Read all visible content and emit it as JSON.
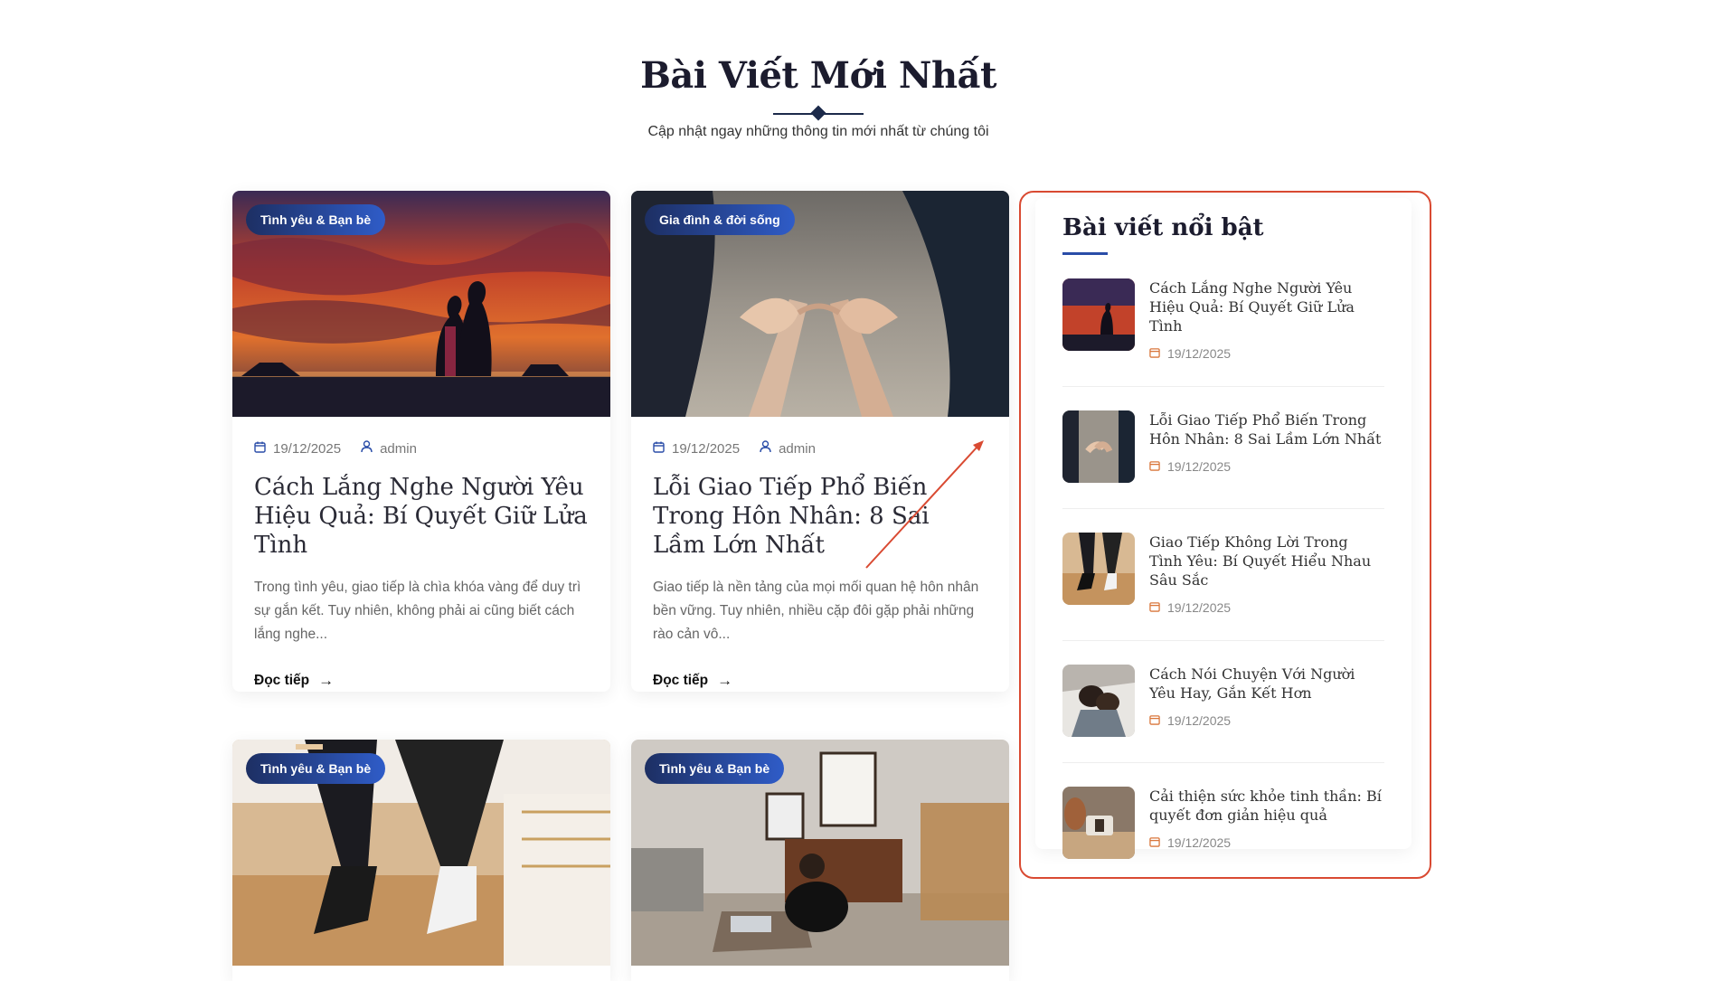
{
  "section": {
    "title": "Bài Viết Mới Nhất",
    "subtitle": "Cập nhật ngay những thông tin mới nhất từ chúng tôi"
  },
  "posts": [
    {
      "category": "Tình yêu & Bạn bè",
      "date": "19/12/2025",
      "author": "admin",
      "title": "Cách Lắng Nghe Người Yêu Hiệu Quả: Bí Quyết Giữ Lửa Tình",
      "excerpt": "Trong tình yêu, giao tiếp là chìa khóa vàng để duy trì sự gắn kết. Tuy nhiên, không phải ai cũng biết cách lắng nghe...",
      "read_more": "Đọc tiếp",
      "image": "sunset-couple-photo"
    },
    {
      "category": "Gia đình & đời sống",
      "date": "19/12/2025",
      "author": "admin",
      "title": "Lỗi Giao Tiếp Phổ Biến Trong Hôn Nhân: 8 Sai Lầm Lớn Nhất",
      "excerpt": "Giao tiếp là nền tảng của mọi mối quan hệ hôn nhân bền vững. Tuy nhiên, nhiều cặp đôi gặp phải những rào cản vô...",
      "read_more": "Đọc tiếp",
      "image": "pinky-promise-photo"
    },
    {
      "category": "Tình yêu & Bạn bè",
      "image": "sitting-legs-photo"
    },
    {
      "category": "Tình yêu & Bạn bè",
      "image": "woman-on-floor-photo"
    }
  ],
  "sidebar": {
    "title": "Bài viết nổi bật",
    "items": [
      {
        "title": "Cách Lắng Nghe Người Yêu Hiệu Quả: Bí Quyết Giữ Lửa Tình",
        "date": "19/12/2025"
      },
      {
        "title": "Lỗi Giao Tiếp Phổ Biến Trong Hôn Nhân: 8 Sai Lầm Lớn Nhất",
        "date": "19/12/2025"
      },
      {
        "title": "Giao Tiếp Không Lời Trong Tình Yêu: Bí Quyết Hiểu Nhau Sâu Sắc",
        "date": "19/12/2025"
      },
      {
        "title": "Cách Nói Chuyện Với Người Yêu Hay, Gắn Kết Hơn",
        "date": "19/12/2025"
      },
      {
        "title": "Cải thiện sức khỏe tinh thần: Bí quyết đơn giản hiệu quả",
        "date": "19/12/2025"
      }
    ]
  },
  "colors": {
    "accent": "#2a4da8",
    "badge_start": "#1d2f63",
    "badge_end": "#2f5cc8",
    "annotation": "#d94a32"
  }
}
